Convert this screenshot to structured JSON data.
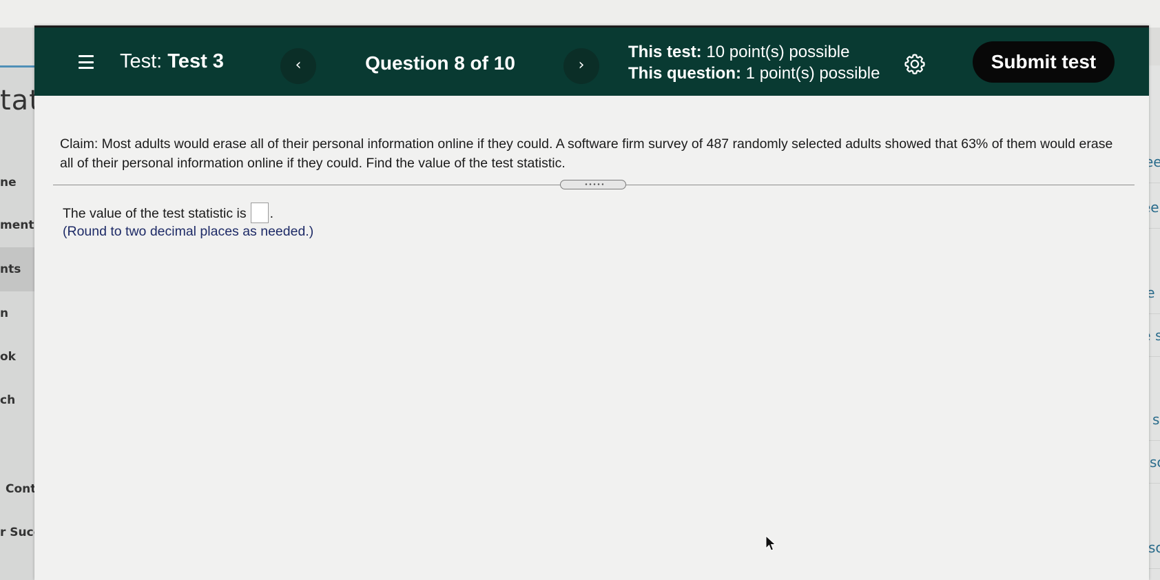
{
  "background": {
    "left_heading": "tati",
    "left_items": [
      "ne",
      "ments",
      "nts",
      "n",
      "ok",
      "ch",
      "Contents",
      "r Success"
    ],
    "left_active_index": 2,
    "right_items": [
      "ee",
      "ee",
      "ee :",
      "ee s",
      "ee s",
      "ee sc",
      "ee sc"
    ]
  },
  "header": {
    "test_label": "Test:",
    "test_name": "Test 3",
    "prev_icon": "‹",
    "next_icon": "›",
    "question_label": "Question 8 of 10",
    "points_test_label": "This test:",
    "points_test_value": "10 point(s) possible",
    "points_question_label": "This question:",
    "points_question_value": "1 point(s) possible",
    "submit_label": "Submit test"
  },
  "question": {
    "claim_text": "Claim: Most adults would erase all of their personal information online if they could. A software firm survey of 487 randomly selected adults showed that 63% of them would erase all of their personal information online if they could. Find the value of the test statistic.",
    "answer_prefix": "The value of the test statistic is",
    "answer_value": "",
    "answer_suffix": ".",
    "round_note": "(Round to two decimal places as needed.)"
  },
  "colors": {
    "header_bg": "#093a32",
    "submit_bg": "#080808",
    "note_text": "#1d2a66",
    "link_teal": "#2a6c8c"
  },
  "icons": {
    "menu": "hamburger-menu-icon",
    "settings": "gear-icon",
    "prev": "chevron-left-icon",
    "next": "chevron-right-icon",
    "pointer": "mouse-cursor-icon"
  }
}
